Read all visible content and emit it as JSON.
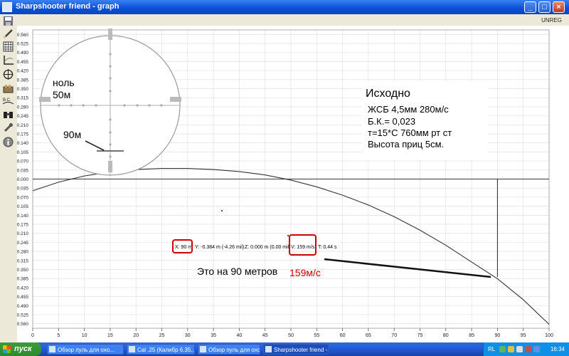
{
  "window": {
    "title": "Sharpshooter friend - graph",
    "unreg": "UNREG"
  },
  "titlebar_buttons": {
    "minimize": "_",
    "maximize": "□",
    "close": "×"
  },
  "toolbar": [
    "save-icon",
    "pencil-icon",
    "grid-icon",
    "axes-icon",
    "crosshair-icon",
    "ammo-icon",
    "bc-icon",
    "binoculars-icon",
    "wrench-icon",
    "info-icon"
  ],
  "toolbar_bc_label": "B.C.",
  "chart_data": {
    "type": "line",
    "y_ticks": [
      "0.560",
      "0.525",
      "0.490",
      "0.455",
      "0.420",
      "0.385",
      "0.350",
      "0.315",
      "0.280",
      "0.245",
      "0.210",
      "0.175",
      "0.140",
      "0.105",
      "0.070",
      "0.035",
      "0.000",
      "0.035",
      "0.070",
      "0.105",
      "0.140",
      "0.175",
      "0.210",
      "0.245",
      "0.280",
      "0.315",
      "0.350",
      "0.385",
      "0.420",
      "0.455",
      "0.490",
      "0.525",
      "0.560"
    ],
    "x_ticks": [
      "0",
      "5",
      "10",
      "15",
      "20",
      "25",
      "30",
      "35",
      "40",
      "45",
      "50",
      "55",
      "60",
      "65",
      "70",
      "75",
      "80",
      "85",
      "90",
      "95",
      "100"
    ],
    "xlim": [
      0,
      100
    ],
    "ylim": [
      -0.575,
      0.575
    ],
    "grid": true,
    "series": [
      {
        "x": [
          0,
          5,
          10,
          15,
          20,
          25,
          30,
          35,
          40,
          45,
          50,
          55,
          60,
          65,
          70,
          75,
          80,
          85,
          90,
          95,
          100
        ],
        "y": [
          -0.045,
          -0.012,
          0.012,
          0.028,
          0.037,
          0.041,
          0.041,
          0.037,
          0.029,
          0.016,
          -0.004,
          -0.03,
          -0.062,
          -0.1,
          -0.145,
          -0.197,
          -0.255,
          -0.32,
          -0.384,
          -0.465,
          -0.56
        ],
        "color": "#333333"
      }
    ],
    "marker_x": 90
  },
  "readout": {
    "x": "X: 90 m",
    "y": "Y: -0.384 m (-4.26 mil)",
    "z": "Z: 0.000 m (0.00 mil)",
    "v": "V: 159 m/s",
    "t": "T: 0.44 s"
  },
  "annotations": {
    "zero_line1": "ноль",
    "zero_line2": "50м",
    "dist90": "90м",
    "info_title": "Исходно",
    "info_lines": [
      "ЖСБ 4,5мм 280м/с",
      "Б.К.= 0,023",
      "т=15*С 760мм рт ст",
      "Высота приц 5см."
    ],
    "note": "Это на 90 метров",
    "velocity": "159м/с",
    "highlight_color": "#cc0000"
  },
  "taskbar": {
    "start": "пуск",
    "tasks": [
      "Обзор пуль для охо...",
      "Cal .25 (Калибр 6.35...",
      "Обзор пуль для охо...",
      "Sharpshooter friend -..."
    ],
    "lang": "RL",
    "clock": "16:34"
  }
}
